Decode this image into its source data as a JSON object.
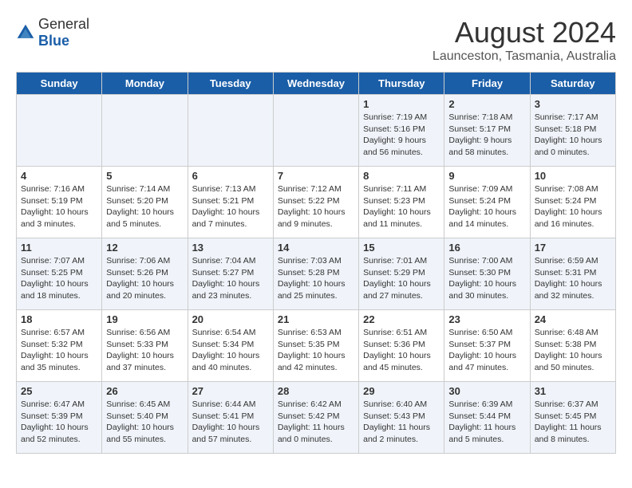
{
  "header": {
    "logo_general": "General",
    "logo_blue": "Blue",
    "main_title": "August 2024",
    "subtitle": "Launceston, Tasmania, Australia"
  },
  "days_of_week": [
    "Sunday",
    "Monday",
    "Tuesday",
    "Wednesday",
    "Thursday",
    "Friday",
    "Saturday"
  ],
  "weeks": [
    [
      {
        "day": "",
        "info": ""
      },
      {
        "day": "",
        "info": ""
      },
      {
        "day": "",
        "info": ""
      },
      {
        "day": "",
        "info": ""
      },
      {
        "day": "1",
        "info": "Sunrise: 7:19 AM\nSunset: 5:16 PM\nDaylight: 9 hours\nand 56 minutes."
      },
      {
        "day": "2",
        "info": "Sunrise: 7:18 AM\nSunset: 5:17 PM\nDaylight: 9 hours\nand 58 minutes."
      },
      {
        "day": "3",
        "info": "Sunrise: 7:17 AM\nSunset: 5:18 PM\nDaylight: 10 hours\nand 0 minutes."
      }
    ],
    [
      {
        "day": "4",
        "info": "Sunrise: 7:16 AM\nSunset: 5:19 PM\nDaylight: 10 hours\nand 3 minutes."
      },
      {
        "day": "5",
        "info": "Sunrise: 7:14 AM\nSunset: 5:20 PM\nDaylight: 10 hours\nand 5 minutes."
      },
      {
        "day": "6",
        "info": "Sunrise: 7:13 AM\nSunset: 5:21 PM\nDaylight: 10 hours\nand 7 minutes."
      },
      {
        "day": "7",
        "info": "Sunrise: 7:12 AM\nSunset: 5:22 PM\nDaylight: 10 hours\nand 9 minutes."
      },
      {
        "day": "8",
        "info": "Sunrise: 7:11 AM\nSunset: 5:23 PM\nDaylight: 10 hours\nand 11 minutes."
      },
      {
        "day": "9",
        "info": "Sunrise: 7:09 AM\nSunset: 5:24 PM\nDaylight: 10 hours\nand 14 minutes."
      },
      {
        "day": "10",
        "info": "Sunrise: 7:08 AM\nSunset: 5:24 PM\nDaylight: 10 hours\nand 16 minutes."
      }
    ],
    [
      {
        "day": "11",
        "info": "Sunrise: 7:07 AM\nSunset: 5:25 PM\nDaylight: 10 hours\nand 18 minutes."
      },
      {
        "day": "12",
        "info": "Sunrise: 7:06 AM\nSunset: 5:26 PM\nDaylight: 10 hours\nand 20 minutes."
      },
      {
        "day": "13",
        "info": "Sunrise: 7:04 AM\nSunset: 5:27 PM\nDaylight: 10 hours\nand 23 minutes."
      },
      {
        "day": "14",
        "info": "Sunrise: 7:03 AM\nSunset: 5:28 PM\nDaylight: 10 hours\nand 25 minutes."
      },
      {
        "day": "15",
        "info": "Sunrise: 7:01 AM\nSunset: 5:29 PM\nDaylight: 10 hours\nand 27 minutes."
      },
      {
        "day": "16",
        "info": "Sunrise: 7:00 AM\nSunset: 5:30 PM\nDaylight: 10 hours\nand 30 minutes."
      },
      {
        "day": "17",
        "info": "Sunrise: 6:59 AM\nSunset: 5:31 PM\nDaylight: 10 hours\nand 32 minutes."
      }
    ],
    [
      {
        "day": "18",
        "info": "Sunrise: 6:57 AM\nSunset: 5:32 PM\nDaylight: 10 hours\nand 35 minutes."
      },
      {
        "day": "19",
        "info": "Sunrise: 6:56 AM\nSunset: 5:33 PM\nDaylight: 10 hours\nand 37 minutes."
      },
      {
        "day": "20",
        "info": "Sunrise: 6:54 AM\nSunset: 5:34 PM\nDaylight: 10 hours\nand 40 minutes."
      },
      {
        "day": "21",
        "info": "Sunrise: 6:53 AM\nSunset: 5:35 PM\nDaylight: 10 hours\nand 42 minutes."
      },
      {
        "day": "22",
        "info": "Sunrise: 6:51 AM\nSunset: 5:36 PM\nDaylight: 10 hours\nand 45 minutes."
      },
      {
        "day": "23",
        "info": "Sunrise: 6:50 AM\nSunset: 5:37 PM\nDaylight: 10 hours\nand 47 minutes."
      },
      {
        "day": "24",
        "info": "Sunrise: 6:48 AM\nSunset: 5:38 PM\nDaylight: 10 hours\nand 50 minutes."
      }
    ],
    [
      {
        "day": "25",
        "info": "Sunrise: 6:47 AM\nSunset: 5:39 PM\nDaylight: 10 hours\nand 52 minutes."
      },
      {
        "day": "26",
        "info": "Sunrise: 6:45 AM\nSunset: 5:40 PM\nDaylight: 10 hours\nand 55 minutes."
      },
      {
        "day": "27",
        "info": "Sunrise: 6:44 AM\nSunset: 5:41 PM\nDaylight: 10 hours\nand 57 minutes."
      },
      {
        "day": "28",
        "info": "Sunrise: 6:42 AM\nSunset: 5:42 PM\nDaylight: 11 hours\nand 0 minutes."
      },
      {
        "day": "29",
        "info": "Sunrise: 6:40 AM\nSunset: 5:43 PM\nDaylight: 11 hours\nand 2 minutes."
      },
      {
        "day": "30",
        "info": "Sunrise: 6:39 AM\nSunset: 5:44 PM\nDaylight: 11 hours\nand 5 minutes."
      },
      {
        "day": "31",
        "info": "Sunrise: 6:37 AM\nSunset: 5:45 PM\nDaylight: 11 hours\nand 8 minutes."
      }
    ]
  ]
}
